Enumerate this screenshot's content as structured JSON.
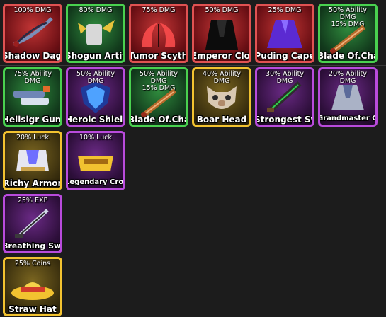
{
  "rows": [
    {
      "items": [
        {
          "name": "Shadow Dagger",
          "stat": "100% DMG",
          "rarity": "red",
          "icon": "shadow-dagger-icon"
        },
        {
          "name": "Shogun Artifact",
          "stat": "80% DMG",
          "rarity": "green",
          "icon": "shogun-artifact-icon"
        },
        {
          "name": "Tumor Scythe",
          "stat": "75% DMG",
          "rarity": "red",
          "icon": "tumor-scythe-icon"
        },
        {
          "name": "Emperor Cloak",
          "stat": "50% DMG",
          "rarity": "red",
          "icon": "emperor-cloak-icon"
        },
        {
          "name": "Puding Cape",
          "stat": "25% DMG",
          "rarity": "red",
          "icon": "puding-cape-icon"
        },
        {
          "name": "Blade Of.Chaos",
          "stat": "50% Ability DMG\n15% DMG",
          "rarity": "green",
          "icon": "blade-of-chaos-icon"
        }
      ]
    },
    {
      "items": [
        {
          "name": "Hellsigr Guns",
          "stat": "75% Ability DMG",
          "rarity": "green",
          "icon": "hellsigr-guns-icon"
        },
        {
          "name": "Heroic Shield",
          "stat": "50% Ability DMG",
          "rarity": "purple",
          "icon": "heroic-shield-icon"
        },
        {
          "name": "Blade Of.Chaos",
          "stat": "50% Ability DMG\n15% DMG",
          "rarity": "green",
          "icon": "blade-of-chaos-icon"
        },
        {
          "name": "Boar Head",
          "stat": "40% Ability DMG",
          "rarity": "gold",
          "icon": "boar-head-icon"
        },
        {
          "name": "Strongest Sword",
          "stat": "30% Ability DMG",
          "rarity": "purple",
          "icon": "strongest-sword-icon"
        },
        {
          "name": "Grandmaster Cloak",
          "stat": "20% Ability DMG",
          "rarity": "purple",
          "icon": "grandmaster-cloak-icon"
        }
      ]
    },
    {
      "items": [
        {
          "name": "Richy Armor",
          "stat": "20% Luck",
          "rarity": "gold",
          "icon": "richy-armor-icon"
        },
        {
          "name": "Legendary Crown",
          "stat": "10% Luck",
          "rarity": "purple",
          "icon": "legendary-crown-icon"
        }
      ]
    },
    {
      "items": [
        {
          "name": "Breathing Sword",
          "stat": "25% EXP",
          "rarity": "purple",
          "icon": "breathing-sword-icon"
        }
      ]
    },
    {
      "items": [
        {
          "name": "Straw Hat",
          "stat": "25% Coins",
          "rarity": "gold",
          "icon": "straw-hat-icon"
        }
      ]
    }
  ]
}
